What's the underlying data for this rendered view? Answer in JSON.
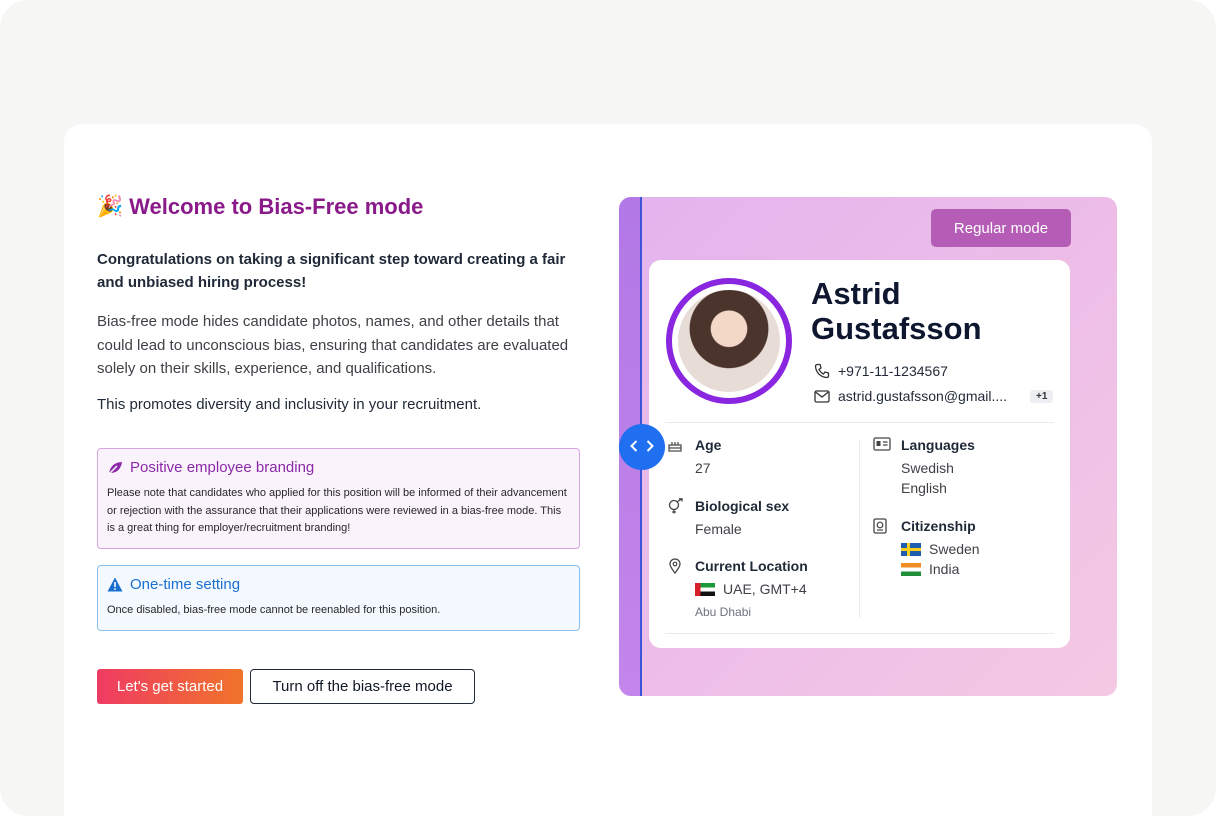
{
  "welcome": {
    "title_icon": "party-popper-icon",
    "title": "Welcome to Bias-Free mode",
    "lead": "Congratulations on taking a significant step toward creating a fair and unbiased hiring process!",
    "description": "Bias-free mode hides candidate photos, names, and other details that could lead to unconscious bias, ensuring that candidates are evaluated solely on their skills, experience, and qualifications.",
    "promotion": "This promotes diversity and inclusivity in your recruitment."
  },
  "alerts": {
    "branding": {
      "icon": "leaf-icon",
      "title": "Positive employee branding",
      "body": "Please note that candidates who applied for this position will be informed of their advancement or rejection with the assurance that their applications were reviewed in a bias-free mode. This is a great thing for employer/recruitment branding!"
    },
    "onetime": {
      "icon": "warning-icon",
      "title": "One-time setting",
      "body": "Once disabled, bias-free mode cannot be reenabled for this position."
    }
  },
  "actions": {
    "start": "Let's get started",
    "turn_off": "Turn off the bias-free mode"
  },
  "preview": {
    "mode_button": "Regular mode",
    "candidate": {
      "name": "Astrid Gustafsson",
      "phone": "+971-11-1234567",
      "email": "astrid.gustafsson@gmail....",
      "email_more": "+1",
      "age_label": "Age",
      "age": "27",
      "sex_label": "Biological sex",
      "sex": "Female",
      "location_label": "Current Location",
      "location": "UAE, GMT+4",
      "city": "Abu Dhabi",
      "languages_label": "Languages",
      "languages": [
        "Swedish",
        "English"
      ],
      "citizenship_label": "Citizenship",
      "citizenship": [
        "Sweden",
        "India"
      ]
    }
  },
  "colors": {
    "title": "#8a1a8a",
    "accent_purple": "#8a25e0",
    "nav_blue": "#1f6ff0",
    "start_gradient": [
      "#ef3b63",
      "#f0742a"
    ]
  }
}
